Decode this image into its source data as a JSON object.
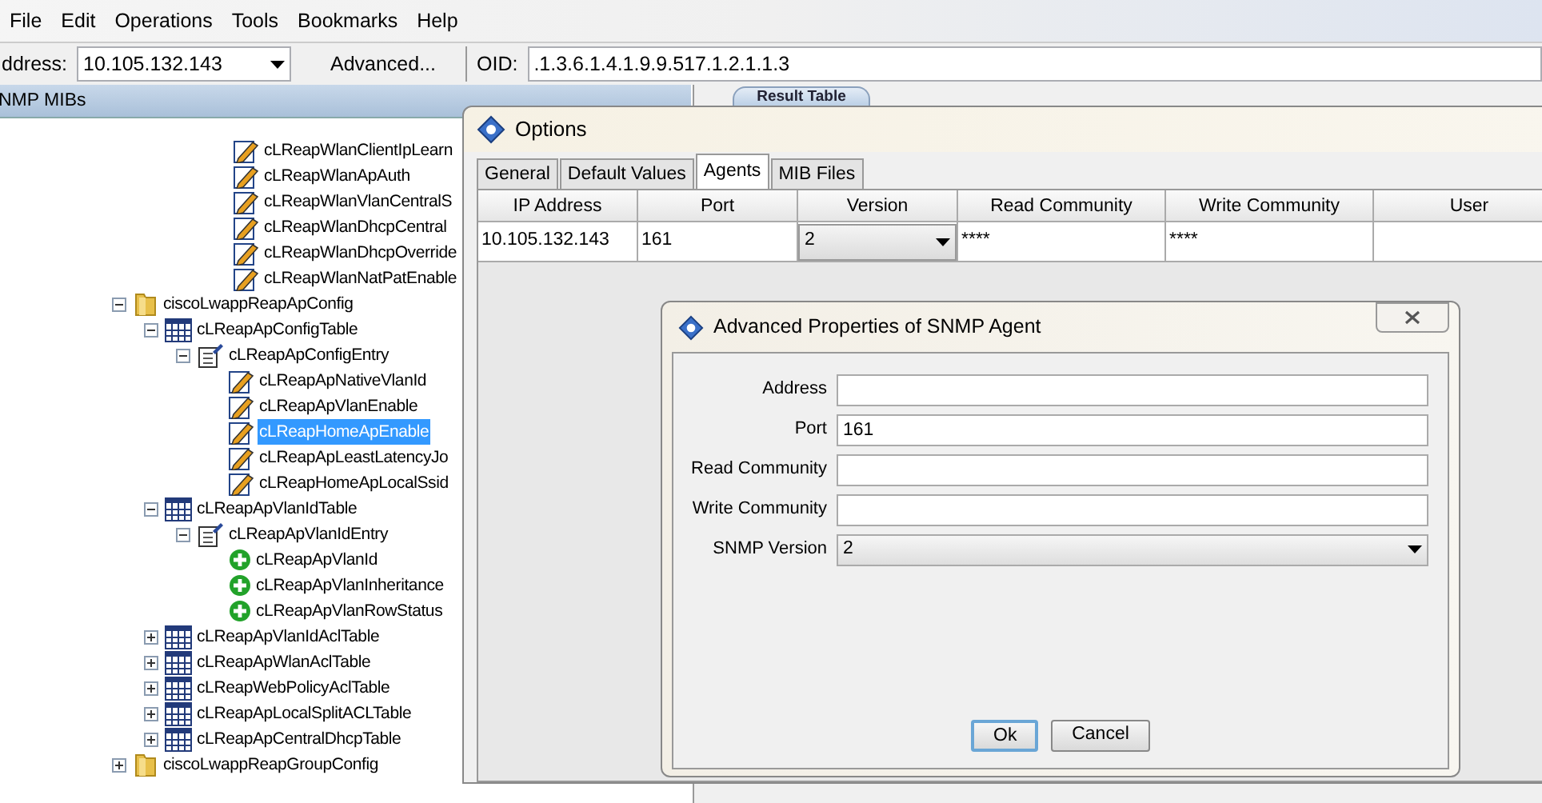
{
  "menu": [
    "File",
    "Edit",
    "Operations",
    "Tools",
    "Bookmarks",
    "Help"
  ],
  "toolbar": {
    "address_label": "ddress:",
    "address": "10.105.132.143",
    "advanced_button": "Advanced...",
    "oid_label": "OID:",
    "oid": ".1.3.6.1.4.1.9.9.517.1.2.1.1.3"
  },
  "mib_panel": {
    "title": "NMP MIBs",
    "scrolled_leaves": [
      {
        "label": "cLReapWlanClientIpLearn",
        "kind": "writable",
        "selected": false
      },
      {
        "label": "cLReapWlanApAuth",
        "kind": "writable",
        "selected": false
      },
      {
        "label": "cLReapWlanVlanCentralS",
        "kind": "writable",
        "selected": false
      },
      {
        "label": "cLReapWlanDhcpCentral",
        "kind": "writable",
        "selected": false
      },
      {
        "label": "cLReapWlanDhcpOverride",
        "kind": "writable",
        "selected": false
      },
      {
        "label": "cLReapWlanNatPatEnable",
        "kind": "writable",
        "selected": false
      }
    ],
    "tree": [
      {
        "label": "ciscoLwappReapApConfig",
        "kind": "folder",
        "expanded": true,
        "children": [
          {
            "label": "cLReapApConfigTable",
            "kind": "table",
            "expanded": true,
            "children": [
              {
                "label": "cLReapApConfigEntry",
                "kind": "entry",
                "expanded": true,
                "children": [
                  {
                    "label": "cLReapApNativeVlanId",
                    "kind": "writable",
                    "selected": false
                  },
                  {
                    "label": "cLReapApVlanEnable",
                    "kind": "writable",
                    "selected": false
                  },
                  {
                    "label": "cLReapHomeApEnable",
                    "kind": "writable",
                    "selected": true
                  },
                  {
                    "label": "cLReapApLeastLatencyJo",
                    "kind": "writable",
                    "selected": false
                  },
                  {
                    "label": "cLReapHomeApLocalSsid",
                    "kind": "writable",
                    "selected": false
                  }
                ]
              }
            ]
          },
          {
            "label": "cLReapApVlanIdTable",
            "kind": "table",
            "expanded": true,
            "children": [
              {
                "label": "cLReapApVlanIdEntry",
                "kind": "entry",
                "expanded": true,
                "children": [
                  {
                    "label": "cLReapApVlanId",
                    "kind": "rowcreate",
                    "selected": false
                  },
                  {
                    "label": "cLReapApVlanInheritance",
                    "kind": "rowcreate",
                    "selected": false
                  },
                  {
                    "label": "cLReapApVlanRowStatus",
                    "kind": "rowcreate",
                    "selected": false
                  }
                ]
              }
            ]
          },
          {
            "label": "cLReapApVlanIdAclTable",
            "kind": "table",
            "expanded": false
          },
          {
            "label": "cLReapApWlanAclTable",
            "kind": "table",
            "expanded": false
          },
          {
            "label": "cLReapWebPolicyAclTable",
            "kind": "table",
            "expanded": false
          },
          {
            "label": "cLReapApLocalSplitACLTable",
            "kind": "table",
            "expanded": false
          },
          {
            "label": "cLReapApCentralDhcpTable",
            "kind": "table",
            "expanded": false
          }
        ]
      },
      {
        "label": "ciscoLwappReapGroupConfig",
        "kind": "folder",
        "expanded": false
      }
    ]
  },
  "result_tab": "Result Table",
  "options_dialog": {
    "title": "Options",
    "tabs": [
      {
        "label": "General",
        "selected": false
      },
      {
        "label": "Default Values",
        "selected": false
      },
      {
        "label": "Agents",
        "selected": true
      },
      {
        "label": "MIB Files",
        "selected": false
      }
    ],
    "columns": [
      "IP Address",
      "Port",
      "Version",
      "Read Community",
      "Write Community",
      "User"
    ],
    "rows": [
      {
        "ip": "10.105.132.143",
        "port": "161",
        "version": "2",
        "read": "****",
        "write": "****"
      }
    ]
  },
  "advanced_dialog": {
    "title": "Advanced Properties of SNMP Agent",
    "fields": [
      {
        "label": "Address",
        "kind": "text"
      },
      {
        "label": "Port",
        "kind": "text",
        "value": "161"
      },
      {
        "label": "Read Community",
        "kind": "text"
      },
      {
        "label": "Write Community",
        "kind": "text"
      },
      {
        "label": "SNMP Version",
        "kind": "select",
        "value": "2"
      }
    ],
    "buttons": [
      {
        "label": "Ok",
        "default": true
      },
      {
        "label": "Cancel",
        "default": false
      }
    ]
  }
}
